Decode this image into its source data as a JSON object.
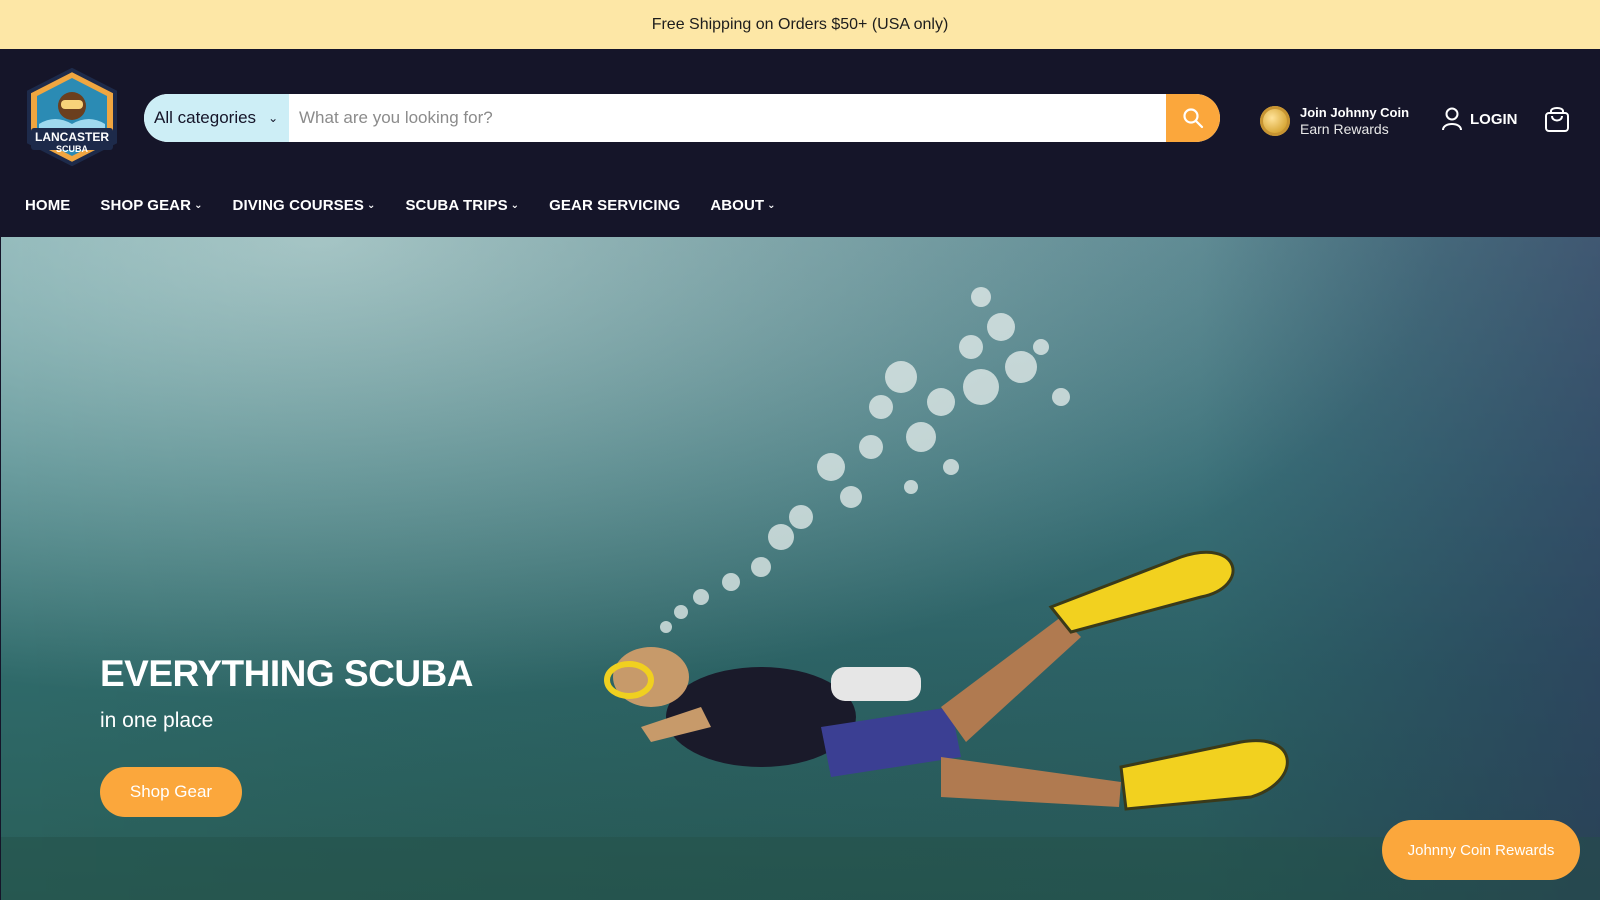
{
  "announcement": {
    "text": "Free Shipping on Orders $50+ (USA only)"
  },
  "brand": {
    "logo_line1": "LANCASTER",
    "logo_line2": "SCUBA"
  },
  "search": {
    "category_label": "All categories",
    "placeholder": "What are you looking for?",
    "icon": "search-icon"
  },
  "rewards_header": {
    "title": "Join Johnny Coin",
    "subtitle": "Earn Rewards"
  },
  "account": {
    "login_label": "LOGIN"
  },
  "nav": {
    "items": [
      {
        "label": "HOME",
        "has_dropdown": false
      },
      {
        "label": "SHOP GEAR",
        "has_dropdown": true
      },
      {
        "label": "DIVING COURSES",
        "has_dropdown": true
      },
      {
        "label": "SCUBA TRIPS",
        "has_dropdown": true
      },
      {
        "label": "GEAR SERVICING",
        "has_dropdown": false
      },
      {
        "label": "ABOUT",
        "has_dropdown": true
      }
    ]
  },
  "hero": {
    "title": "EVERYTHING SCUBA",
    "subtitle": "in one place",
    "cta_label": "Shop Gear"
  },
  "floating": {
    "rewards_label": "Johnny Coin Rewards"
  },
  "colors": {
    "announcement_bg": "#fde7a6",
    "header_bg": "#151529",
    "accent": "#fba73c",
    "category_bg": "#cdeef6"
  }
}
